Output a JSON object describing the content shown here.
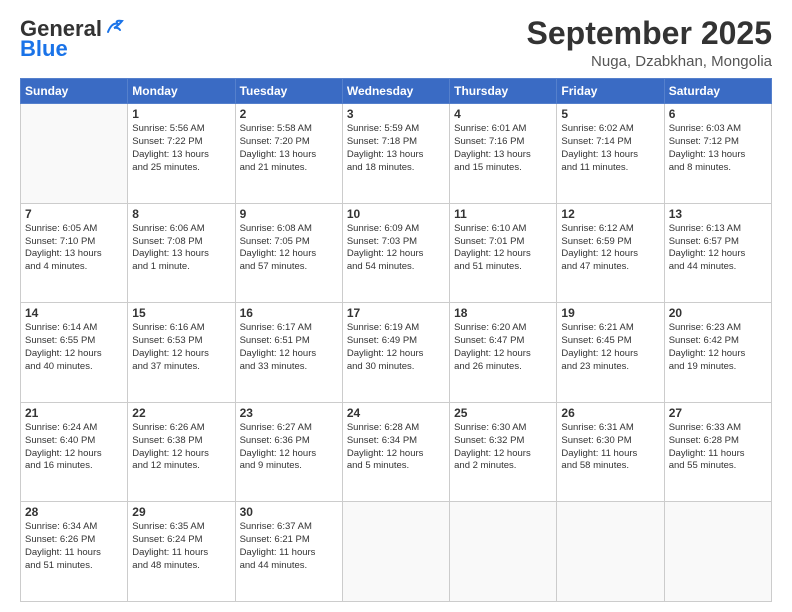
{
  "logo": {
    "line1": "General",
    "line2": "Blue"
  },
  "title": "September 2025",
  "location": "Nuga, Dzabkhan, Mongolia",
  "days_header": [
    "Sunday",
    "Monday",
    "Tuesday",
    "Wednesday",
    "Thursday",
    "Friday",
    "Saturday"
  ],
  "weeks": [
    [
      {
        "day": "",
        "info": ""
      },
      {
        "day": "1",
        "info": "Sunrise: 5:56 AM\nSunset: 7:22 PM\nDaylight: 13 hours\nand 25 minutes."
      },
      {
        "day": "2",
        "info": "Sunrise: 5:58 AM\nSunset: 7:20 PM\nDaylight: 13 hours\nand 21 minutes."
      },
      {
        "day": "3",
        "info": "Sunrise: 5:59 AM\nSunset: 7:18 PM\nDaylight: 13 hours\nand 18 minutes."
      },
      {
        "day": "4",
        "info": "Sunrise: 6:01 AM\nSunset: 7:16 PM\nDaylight: 13 hours\nand 15 minutes."
      },
      {
        "day": "5",
        "info": "Sunrise: 6:02 AM\nSunset: 7:14 PM\nDaylight: 13 hours\nand 11 minutes."
      },
      {
        "day": "6",
        "info": "Sunrise: 6:03 AM\nSunset: 7:12 PM\nDaylight: 13 hours\nand 8 minutes."
      }
    ],
    [
      {
        "day": "7",
        "info": "Sunrise: 6:05 AM\nSunset: 7:10 PM\nDaylight: 13 hours\nand 4 minutes."
      },
      {
        "day": "8",
        "info": "Sunrise: 6:06 AM\nSunset: 7:08 PM\nDaylight: 13 hours\nand 1 minute."
      },
      {
        "day": "9",
        "info": "Sunrise: 6:08 AM\nSunset: 7:05 PM\nDaylight: 12 hours\nand 57 minutes."
      },
      {
        "day": "10",
        "info": "Sunrise: 6:09 AM\nSunset: 7:03 PM\nDaylight: 12 hours\nand 54 minutes."
      },
      {
        "day": "11",
        "info": "Sunrise: 6:10 AM\nSunset: 7:01 PM\nDaylight: 12 hours\nand 51 minutes."
      },
      {
        "day": "12",
        "info": "Sunrise: 6:12 AM\nSunset: 6:59 PM\nDaylight: 12 hours\nand 47 minutes."
      },
      {
        "day": "13",
        "info": "Sunrise: 6:13 AM\nSunset: 6:57 PM\nDaylight: 12 hours\nand 44 minutes."
      }
    ],
    [
      {
        "day": "14",
        "info": "Sunrise: 6:14 AM\nSunset: 6:55 PM\nDaylight: 12 hours\nand 40 minutes."
      },
      {
        "day": "15",
        "info": "Sunrise: 6:16 AM\nSunset: 6:53 PM\nDaylight: 12 hours\nand 37 minutes."
      },
      {
        "day": "16",
        "info": "Sunrise: 6:17 AM\nSunset: 6:51 PM\nDaylight: 12 hours\nand 33 minutes."
      },
      {
        "day": "17",
        "info": "Sunrise: 6:19 AM\nSunset: 6:49 PM\nDaylight: 12 hours\nand 30 minutes."
      },
      {
        "day": "18",
        "info": "Sunrise: 6:20 AM\nSunset: 6:47 PM\nDaylight: 12 hours\nand 26 minutes."
      },
      {
        "day": "19",
        "info": "Sunrise: 6:21 AM\nSunset: 6:45 PM\nDaylight: 12 hours\nand 23 minutes."
      },
      {
        "day": "20",
        "info": "Sunrise: 6:23 AM\nSunset: 6:42 PM\nDaylight: 12 hours\nand 19 minutes."
      }
    ],
    [
      {
        "day": "21",
        "info": "Sunrise: 6:24 AM\nSunset: 6:40 PM\nDaylight: 12 hours\nand 16 minutes."
      },
      {
        "day": "22",
        "info": "Sunrise: 6:26 AM\nSunset: 6:38 PM\nDaylight: 12 hours\nand 12 minutes."
      },
      {
        "day": "23",
        "info": "Sunrise: 6:27 AM\nSunset: 6:36 PM\nDaylight: 12 hours\nand 9 minutes."
      },
      {
        "day": "24",
        "info": "Sunrise: 6:28 AM\nSunset: 6:34 PM\nDaylight: 12 hours\nand 5 minutes."
      },
      {
        "day": "25",
        "info": "Sunrise: 6:30 AM\nSunset: 6:32 PM\nDaylight: 12 hours\nand 2 minutes."
      },
      {
        "day": "26",
        "info": "Sunrise: 6:31 AM\nSunset: 6:30 PM\nDaylight: 11 hours\nand 58 minutes."
      },
      {
        "day": "27",
        "info": "Sunrise: 6:33 AM\nSunset: 6:28 PM\nDaylight: 11 hours\nand 55 minutes."
      }
    ],
    [
      {
        "day": "28",
        "info": "Sunrise: 6:34 AM\nSunset: 6:26 PM\nDaylight: 11 hours\nand 51 minutes."
      },
      {
        "day": "29",
        "info": "Sunrise: 6:35 AM\nSunset: 6:24 PM\nDaylight: 11 hours\nand 48 minutes."
      },
      {
        "day": "30",
        "info": "Sunrise: 6:37 AM\nSunset: 6:21 PM\nDaylight: 11 hours\nand 44 minutes."
      },
      {
        "day": "",
        "info": ""
      },
      {
        "day": "",
        "info": ""
      },
      {
        "day": "",
        "info": ""
      },
      {
        "day": "",
        "info": ""
      }
    ]
  ]
}
